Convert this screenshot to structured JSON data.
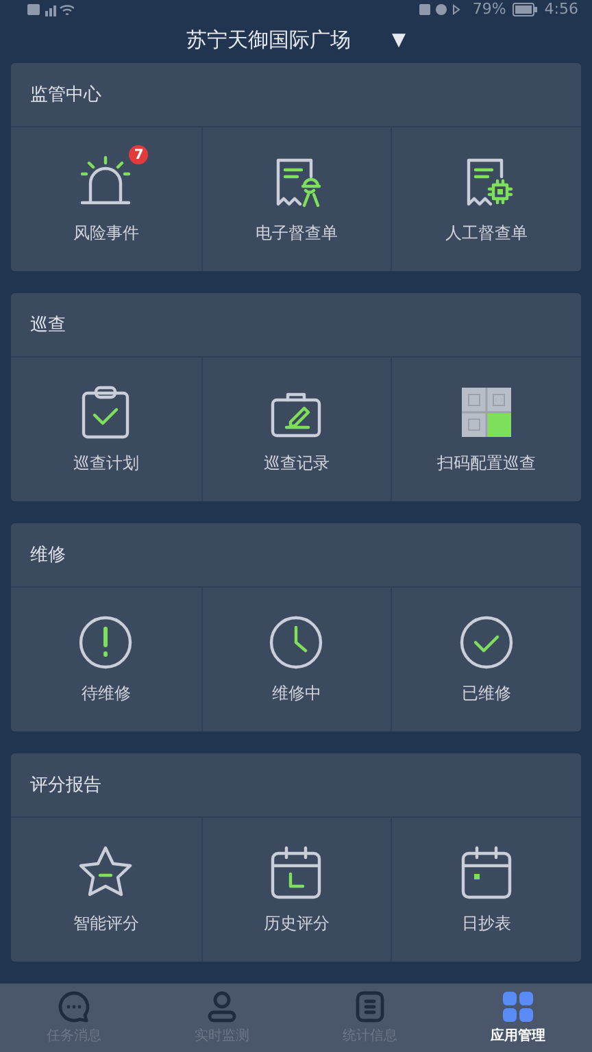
{
  "status_bar": {
    "battery": "79%",
    "time": "4:56"
  },
  "header": {
    "title": "苏宁天御国际广场",
    "dropdown": "▼"
  },
  "sections": [
    {
      "title": "监管中心",
      "items": [
        {
          "label": "风险事件",
          "kind": "alarm",
          "badge": "7"
        },
        {
          "label": "电子督查单",
          "kind": "receipt-person"
        },
        {
          "label": "人工督查单",
          "kind": "receipt-gear"
        }
      ]
    },
    {
      "title": "巡查",
      "items": [
        {
          "label": "巡查计划",
          "kind": "clipboard"
        },
        {
          "label": "巡查记录",
          "kind": "case-pen"
        },
        {
          "label": "扫码配置巡查",
          "kind": "qr"
        }
      ]
    },
    {
      "title": "维修",
      "items": [
        {
          "label": "待维修",
          "kind": "exclaim"
        },
        {
          "label": "维修中",
          "kind": "clock"
        },
        {
          "label": "已维修",
          "kind": "check"
        }
      ]
    },
    {
      "title": "评分报告",
      "items": [
        {
          "label": "智能评分",
          "kind": "star"
        },
        {
          "label": "历史评分",
          "kind": "cal-l"
        },
        {
          "label": "日抄表",
          "kind": "cal-dot"
        }
      ]
    }
  ],
  "tabs": [
    {
      "label": "任务消息",
      "kind": "chat",
      "selected": false
    },
    {
      "label": "实时监测",
      "kind": "person",
      "selected": false
    },
    {
      "label": "统计信息",
      "kind": "doc",
      "selected": false
    },
    {
      "label": "应用管理",
      "kind": "grid",
      "selected": true
    }
  ]
}
